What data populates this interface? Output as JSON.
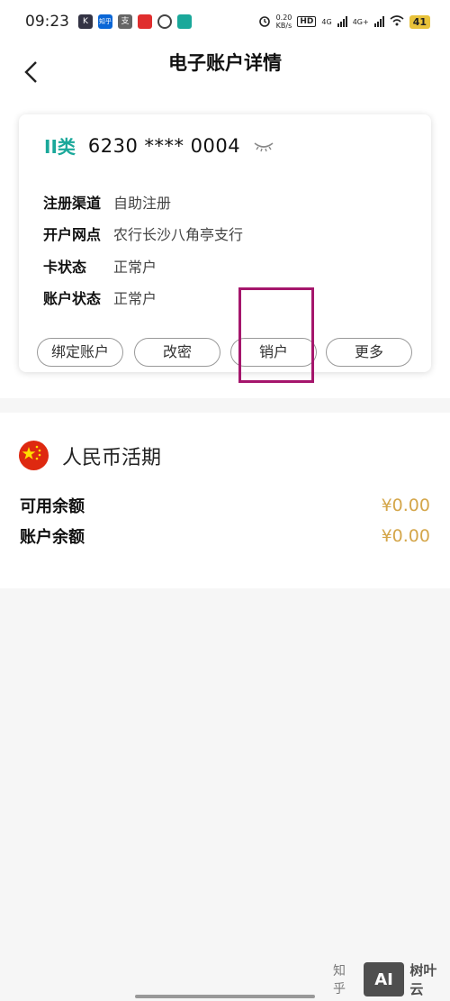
{
  "status_bar": {
    "time": "09:23",
    "apps": [
      {
        "icon": "k-app-icon",
        "label": "K",
        "color": "#333344"
      },
      {
        "icon": "zhihu-app-icon",
        "label": "知乎",
        "color": "#0a66d6"
      },
      {
        "icon": "alipay-app-icon",
        "label": "支",
        "color": "#666666"
      },
      {
        "icon": "shop-app-icon",
        "label": "",
        "color": "#e02e2e"
      },
      {
        "icon": "loop-app-icon",
        "label": "",
        "color": "#444444"
      },
      {
        "icon": "bank-app-icon",
        "label": "",
        "color": "#1aa89a"
      }
    ],
    "net_speed_value": "0.20",
    "net_speed_unit": "KB/s",
    "hd_label": "HD",
    "sim1": "4G",
    "sim2": "4G+",
    "battery": "41"
  },
  "nav": {
    "title": "电子账户详情"
  },
  "card": {
    "class_badge": "II类",
    "number": "6230 **** 0004",
    "rows": [
      {
        "label": "注册渠道",
        "value": "自助注册"
      },
      {
        "label": "开户网点",
        "value": "农行长沙八角亭支行"
      },
      {
        "label": "卡状态",
        "value": "正常户"
      },
      {
        "label": "账户状态",
        "value": "正常户"
      }
    ],
    "buttons": {
      "bind": "绑定账户",
      "change_pwd": "改密",
      "close": "销户",
      "more": "更多"
    }
  },
  "balance": {
    "currency": "人民币活期",
    "available_label": "可用余额",
    "available_value": "¥0.00",
    "account_label": "账户余额",
    "account_value": "¥0.00"
  },
  "watermark": {
    "zhihu": "知乎",
    "logo": "AI",
    "brand": "树叶云"
  },
  "colors": {
    "accent_teal": "#1aa89a",
    "amount_gold": "#d4a64a",
    "highlight": "#a5166c"
  }
}
